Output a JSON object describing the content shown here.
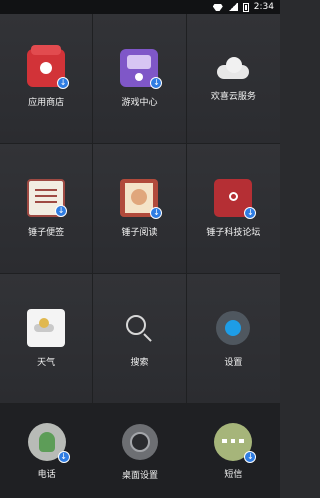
{
  "status_bar": {
    "time": "2:34"
  },
  "grid": [
    {
      "name": "app-store",
      "label": "应用商店",
      "icon": "app-store-icon",
      "download_badge": true
    },
    {
      "name": "game-center",
      "label": "游戏中心",
      "icon": "game-center-icon",
      "download_badge": true
    },
    {
      "name": "cloud-service",
      "label": "欢喜云服务",
      "icon": "cloud-icon",
      "download_badge": false
    },
    {
      "name": "notes",
      "label": "锤子便签",
      "icon": "notes-icon",
      "download_badge": true
    },
    {
      "name": "reader",
      "label": "锤子阅读",
      "icon": "reader-icon",
      "download_badge": true
    },
    {
      "name": "forum",
      "label": "锤子科技论坛",
      "icon": "forum-icon",
      "download_badge": true
    },
    {
      "name": "weather",
      "label": "天气",
      "icon": "weather-icon",
      "download_badge": false
    },
    {
      "name": "search",
      "label": "搜索",
      "icon": "search-icon",
      "download_badge": false
    },
    {
      "name": "settings",
      "label": "设置",
      "icon": "settings-icon",
      "download_badge": false
    }
  ],
  "dock": [
    {
      "name": "phone",
      "label": "电话",
      "icon": "phone-icon",
      "download_badge": true
    },
    {
      "name": "desktop-settings",
      "label": "桌面设置",
      "icon": "desktop-settings-icon",
      "download_badge": false
    },
    {
      "name": "messages",
      "label": "短信",
      "icon": "messages-icon",
      "download_badge": true
    }
  ],
  "colors": {
    "badge": "#2f7de3",
    "background": "#2a2b2e"
  }
}
